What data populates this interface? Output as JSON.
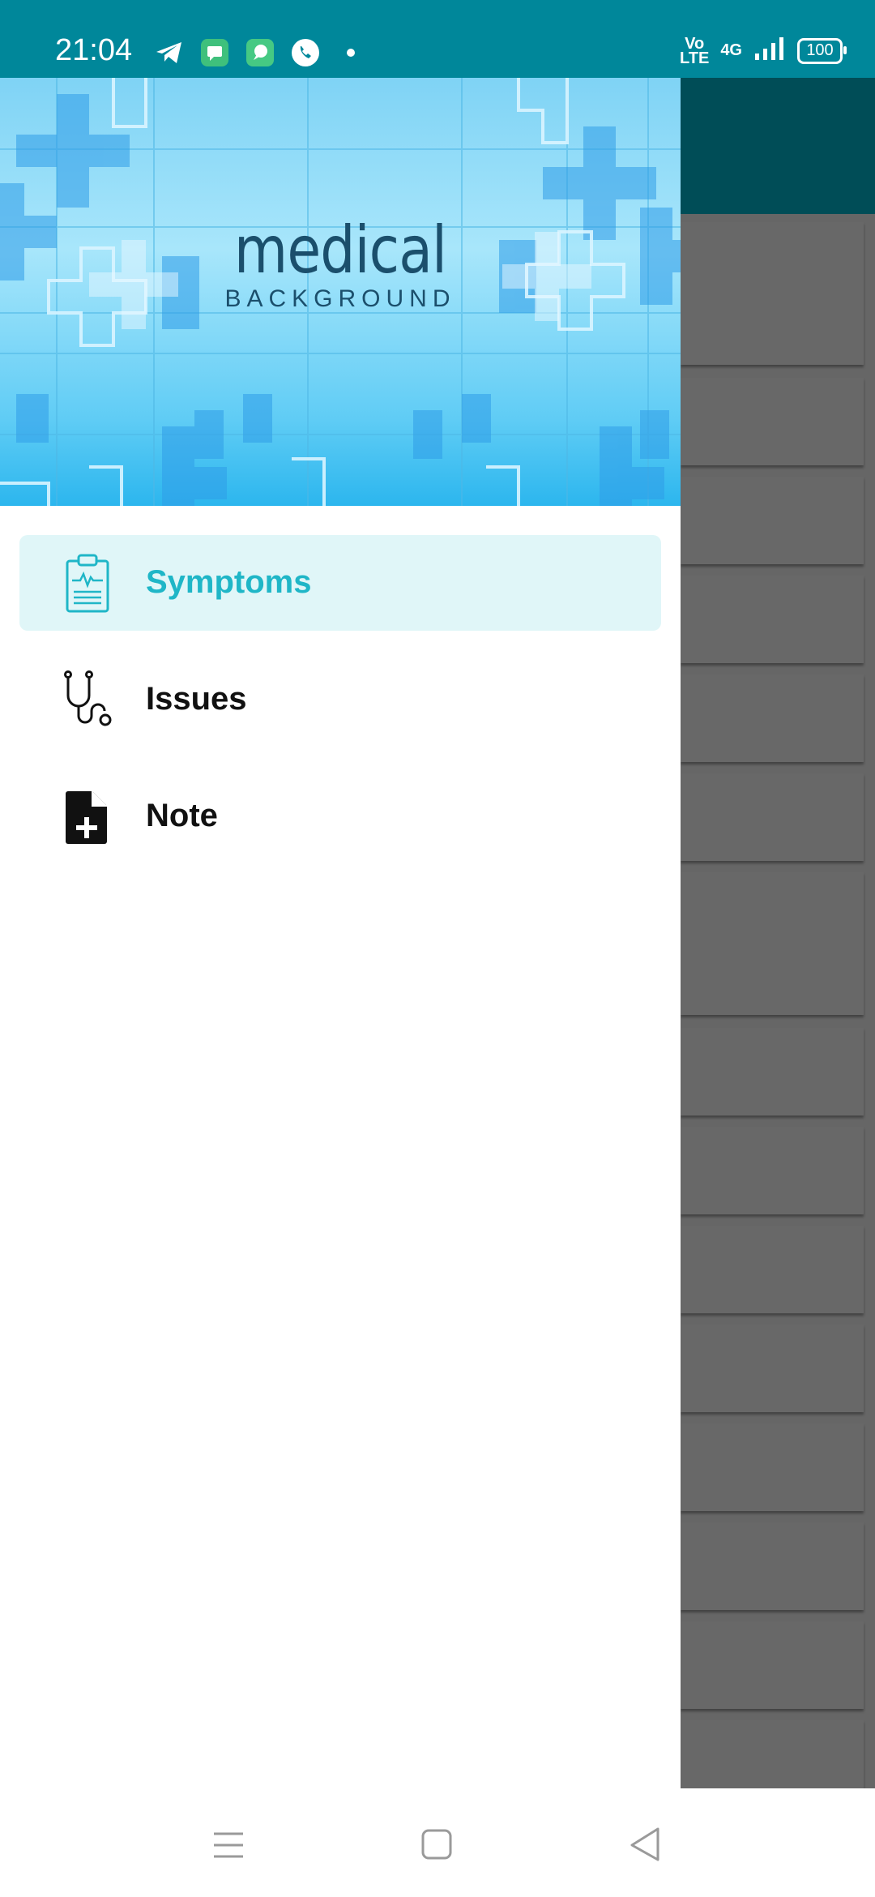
{
  "status_bar": {
    "time": "21:04",
    "volte": "Vo\nLTE",
    "network": "4G",
    "battery": "100",
    "icons": [
      "telegram-icon",
      "message-icon",
      "chat-bubble-icon",
      "phone-call-icon",
      "notification-dot-icon",
      "signal-icon",
      "battery-icon"
    ]
  },
  "drawer": {
    "header": {
      "title": "medical",
      "subtitle": "BACKGROUND"
    },
    "items": [
      {
        "label": "Symptoms",
        "icon": "clipboard-ecg-icon",
        "active": true
      },
      {
        "label": "Issues",
        "icon": "stethoscope-icon",
        "active": false
      },
      {
        "label": "Note",
        "icon": "file-add-icon",
        "active": false
      }
    ]
  },
  "colors": {
    "status_bar": "#00879a",
    "active_item_bg": "#e0f6f8",
    "active_item_text": "#1fb6c7",
    "scrim": "#666666",
    "behind_toolbar": "#004d57"
  },
  "nav_bar": {
    "icons": [
      "menu-icon",
      "home-icon",
      "back-icon"
    ]
  }
}
